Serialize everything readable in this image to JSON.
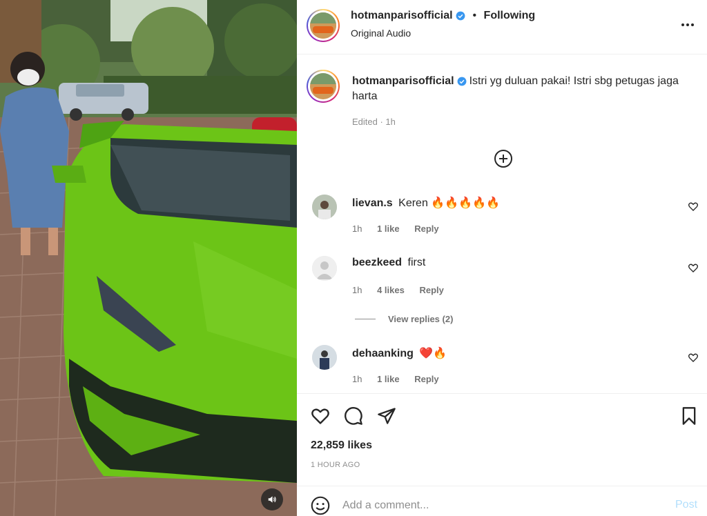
{
  "post": {
    "author": "hotmanparisofficial",
    "audio": "Original Audio",
    "follow_status": "Following",
    "caption": "Istri yg duluan pakai! Istri sbg petugas jaga harta",
    "edited": "Edited · 1h",
    "likes": "22,859 likes",
    "time": "1 HOUR AGO"
  },
  "icons": {
    "verified": "verified-badge-icon",
    "more": "more-options-icon",
    "add": "plus-circle-icon",
    "like": "heart-icon",
    "comment": "comment-icon",
    "share": "share-icon",
    "save": "bookmark-icon",
    "emoji": "emoji-icon",
    "mute": "speaker-icon"
  },
  "comments": [
    {
      "user": "lievan.s",
      "text": "Keren 🔥🔥🔥🔥🔥",
      "time": "1h",
      "likes": "1 like",
      "reply": "Reply"
    },
    {
      "user": "beezkeed",
      "text": "first",
      "time": "1h",
      "likes": "4 likes",
      "reply": "Reply",
      "view_replies": "View replies (2)"
    },
    {
      "user": "dehaanking",
      "text": "❤️🔥",
      "time": "1h",
      "likes": "1 like",
      "reply": "Reply"
    }
  ],
  "composer": {
    "placeholder": "Add a comment...",
    "post_label": "Post"
  },
  "colors": {
    "verified": "#3897f0",
    "post_button": "#b2dffc",
    "car": "#6cc417"
  }
}
